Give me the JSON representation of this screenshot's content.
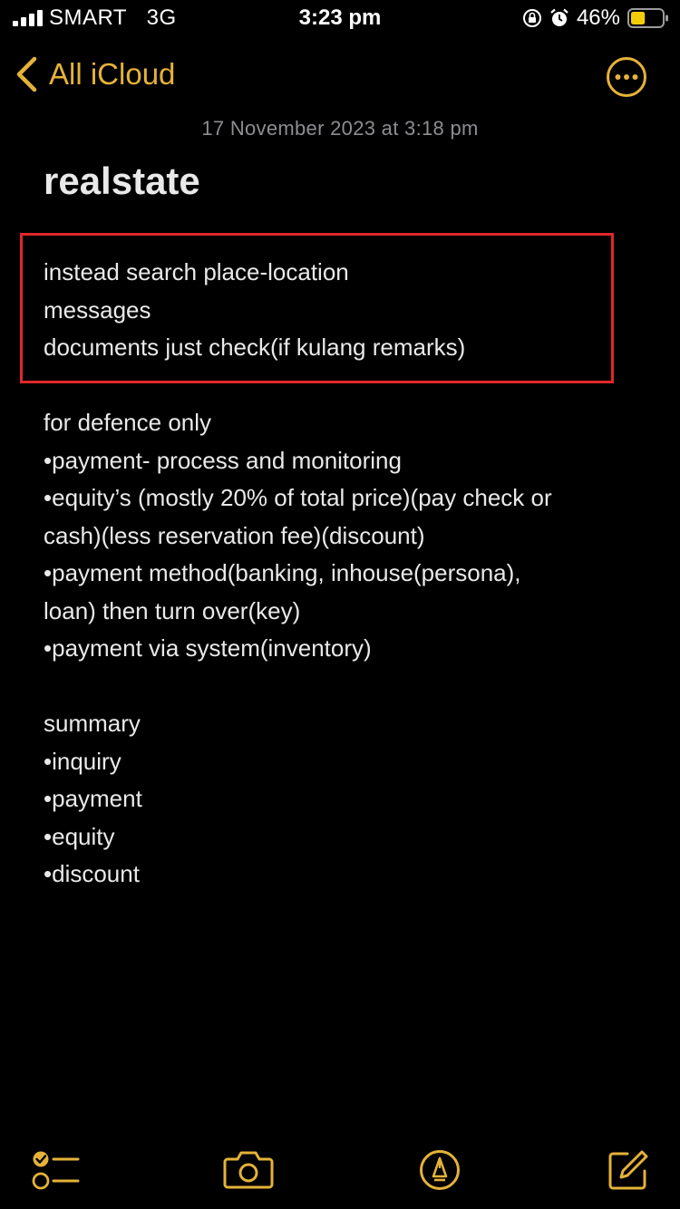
{
  "status_bar": {
    "carrier": "SMART",
    "network": "3G",
    "time": "3:23 pm",
    "battery": "46%",
    "battery_level": 0.46
  },
  "nav": {
    "back_label": "All iCloud"
  },
  "note": {
    "date": "17 November 2023 at 3:18 pm",
    "title": "realstate",
    "lines": [
      "instead search place-location",
      "messages",
      "documents just check(if kulang remarks)",
      "",
      "for defence only",
      "•payment- process and monitoring",
      "•equity’s (mostly 20% of total price)(pay check or",
      "cash)(less reservation fee)(discount)",
      "•payment method(banking, inhouse(persona),",
      "loan) then turn over(key)",
      "•payment via system(inventory)",
      "",
      "summary",
      "•inquiry",
      "•payment",
      "•equity",
      "•discount"
    ]
  },
  "icons": {
    "back": "chevron-left-icon",
    "more": "ellipsis-circle-icon",
    "checklist": "checklist-icon",
    "camera": "camera-icon",
    "markup": "pen-tip-icon",
    "compose": "compose-icon"
  },
  "colors": {
    "accent": "#e5b239",
    "highlight_border": "#e0262b",
    "background": "#000000",
    "text": "#e9e9e9",
    "secondary_text": "#8d8d92"
  }
}
